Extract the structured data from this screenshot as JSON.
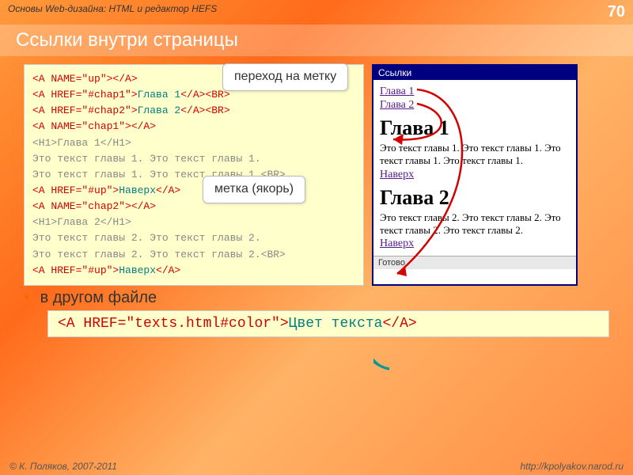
{
  "header": {
    "course": "Основы Web-дизайна: HTML и редактор HEFS",
    "page_number": "70",
    "title": "Ссылки внутри страницы"
  },
  "callouts": {
    "jump": "переход на метку",
    "anchor": "метка (якорь)"
  },
  "code": {
    "l1a": "<A NAME=\"up\">",
    "l1b": "</A>",
    "l2a": "<A HREF=\"#chap1\">",
    "l2b": "Глава 1",
    "l2c": "</A><BR>",
    "l3a": "<A HREF=\"#chap2\">",
    "l3b": "Глава 2",
    "l3c": "</A><BR>",
    "l4a": "<A NAME=\"chap1\">",
    "l4b": "</A>",
    "l5": "<H1>Глава 1</H1>",
    "l6": "Это текст главы 1. Это текст главы 1.",
    "l7": "Это текст главы 1. Это текст главы 1.<BR>",
    "l8a": "<A HREF=\"#up\">",
    "l8b": "Наверх",
    "l8c": "</A>",
    "l9a": "<A NAME=\"chap2\">",
    "l9b": "</A>",
    "l10": "<H1>Глава 2</H1>",
    "l11": "Это текст главы 2. Это текст главы 2.",
    "l12": "Это текст главы 2. Это текст главы 2.<BR>",
    "l13a": "<A HREF=\"#up\">",
    "l13b": "Наверх",
    "l13c": "</A>"
  },
  "browser": {
    "title": "Ссылки",
    "link1": "Глава 1",
    "link2": "Глава 2",
    "h1a": "Глава 1",
    "t1": "Это текст главы 1. Это текст главы 1. Это текст главы 1. Это текст главы 1.",
    "up": "Наверх",
    "h1b": "Глава 2",
    "t2": "Это текст главы 2. Это текст главы 2. Это текст главы 2. Это текст главы 2.",
    "status": "Готово"
  },
  "other_file": "в другом файле",
  "bottom": {
    "open": "<A HREF=\"texts.html#color\">",
    "text": "Цвет текста",
    "close": "</A>"
  },
  "footer": {
    "copyright": "© К. Поляков, 2007-2011",
    "url": "http://kpolyakov.narod.ru"
  }
}
